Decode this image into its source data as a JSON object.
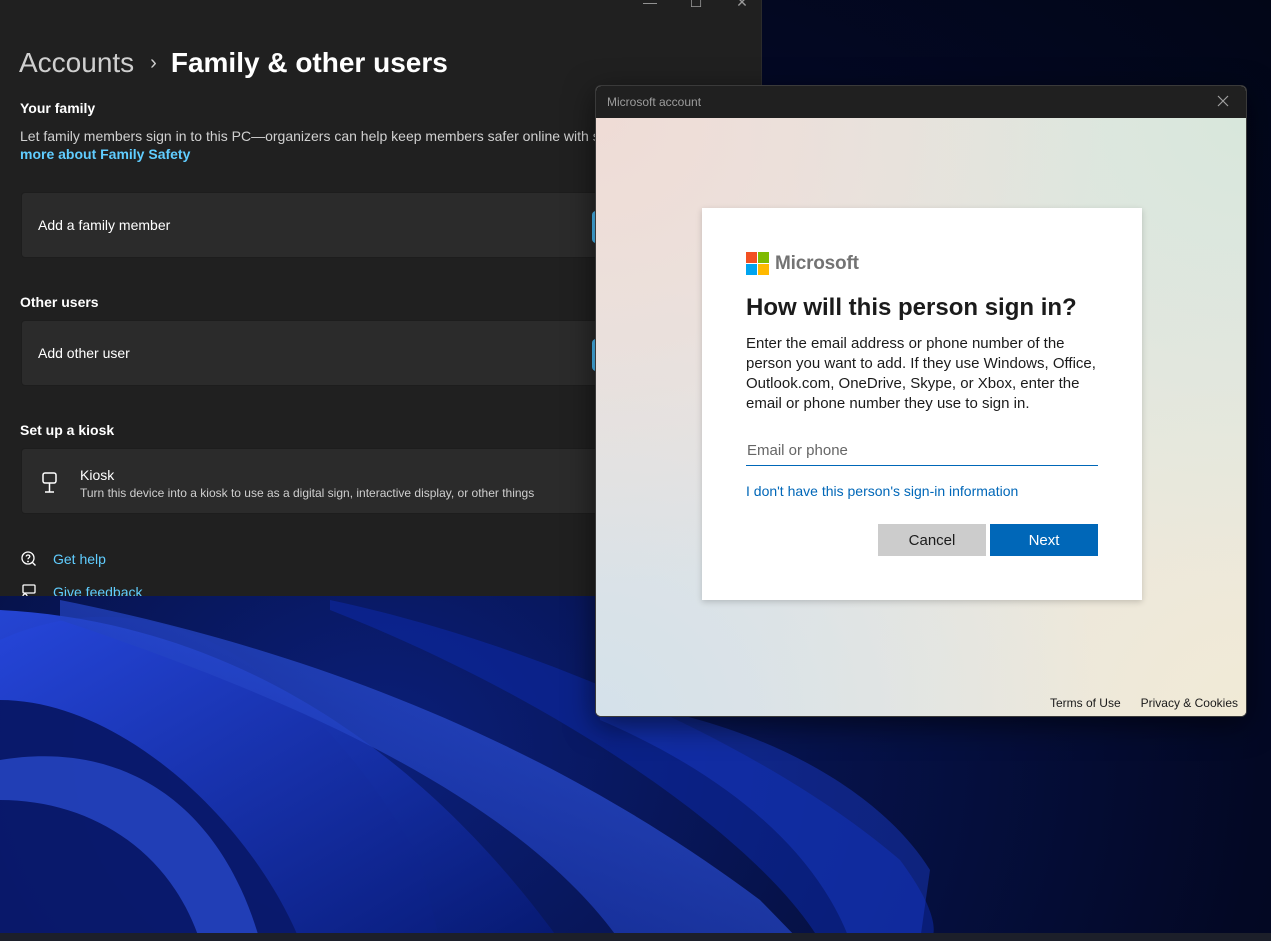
{
  "settings": {
    "breadcrumb": {
      "parent": "Accounts",
      "separator": "›",
      "current": "Family & other users"
    },
    "window_controls": {
      "minimize": "—",
      "maximize": "☐",
      "close": "✕"
    },
    "your_family": {
      "title": "Your family",
      "description": "Let family members sign in to this PC—organizers can help keep members safer online with s",
      "link": "more about Family Safety",
      "add_label": "Add a family member"
    },
    "other_users": {
      "title": "Other users",
      "add_label": "Add other user"
    },
    "kiosk": {
      "title": "Set up a kiosk",
      "item_title": "Kiosk",
      "item_description": "Turn this device into a kiosk to use as a digital sign, interactive display, or other things"
    },
    "help": {
      "get_help": "Get help",
      "give_feedback": "Give feedback"
    },
    "accent_color": "#60cdff"
  },
  "dialog": {
    "title": "Microsoft account",
    "brand": "Microsoft",
    "heading": "How will this person sign in?",
    "description": "Enter the email address or phone number of the person you want to add. If they use Windows, Office, Outlook.com, OneDrive, Skype, or Xbox, enter the email or phone number they use to sign in.",
    "input": {
      "placeholder": "Email or phone",
      "value": ""
    },
    "no_info_link": "I don't have this person's sign-in information",
    "cancel_label": "Cancel",
    "next_label": "Next",
    "footer": {
      "terms": "Terms of Use",
      "privacy": "Privacy & Cookies"
    },
    "logo_colors": [
      "#f25022",
      "#7fba00",
      "#00a4ef",
      "#ffb900"
    ],
    "accent_color": "#0067b8"
  }
}
